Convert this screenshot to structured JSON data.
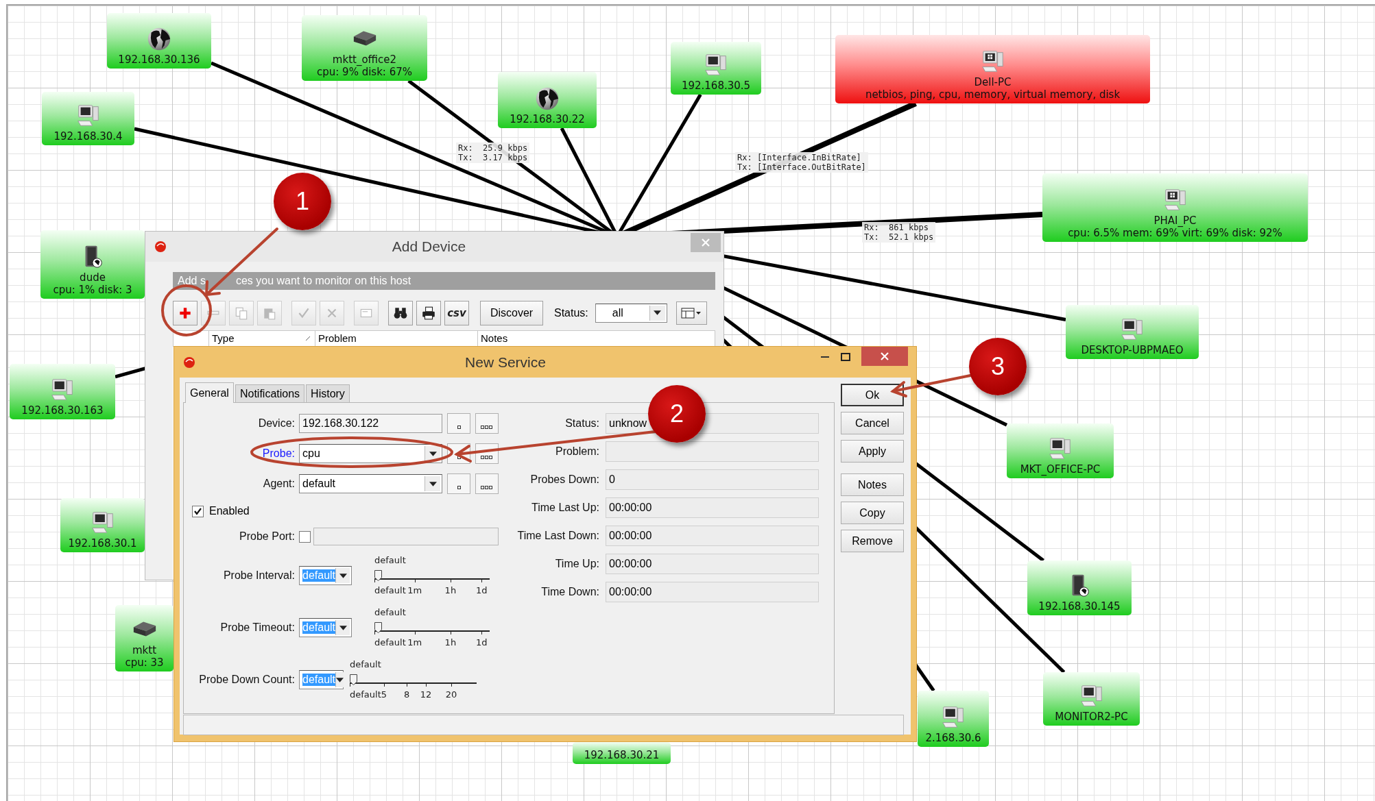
{
  "map": {
    "nodes": [
      {
        "label": "192.168.30.136",
        "down": false
      },
      {
        "label": "mktt_office2",
        "detail": "cpu: 9% disk: 67%",
        "down": false
      },
      {
        "label": "192.168.30.4",
        "down": false
      },
      {
        "label": "192.168.30.22",
        "down": false
      },
      {
        "label": "192.168.30.5",
        "down": false
      },
      {
        "label": "Dell-PC",
        "detail": "netbios, ping, cpu, memory, virtual memory, disk",
        "down": true
      },
      {
        "label": "PHAI_PC",
        "detail": "cpu: 6.5% mem: 69% virt: 69% disk: 92%",
        "down": false
      },
      {
        "label": "dude",
        "detail": "cpu: 1% disk: 3",
        "down": false
      },
      {
        "label": "DESKTOP-UBPMAEO",
        "down": false
      },
      {
        "label": "192.168.30.163",
        "down": false
      },
      {
        "label": "MKT_OFFICE-PC",
        "down": false
      },
      {
        "label": "192.168.30.1",
        "down": false
      },
      {
        "label": "mktt",
        "detail": "cpu: 33",
        "down": false
      },
      {
        "label": "192.168.30.145",
        "down": false
      },
      {
        "label": "MONITOR2-PC",
        "down": false
      },
      {
        "label": "2.168.30.6",
        "down": false
      },
      {
        "label": "192.168.30.21",
        "down": false
      }
    ],
    "link_labels": [
      {
        "rx": "Rx:  25.9 kbps",
        "tx": "Tx:  3.17 kbps"
      },
      {
        "rx": "Rx: [Interface.InBitRate]",
        "tx": "Tx: [Interface.OutBitRate]"
      },
      {
        "rx": "Rx:  861 kbps",
        "tx": "Tx:  52.1 kbps"
      }
    ]
  },
  "add_device": {
    "title": "Add Device",
    "active": false,
    "info_start": "Add s",
    "info_end": "ces you want to monitor on this host",
    "toolbar": [
      {
        "disabled": false
      },
      {
        "disabled": true
      },
      {
        "disabled": true
      },
      {
        "disabled": true
      },
      {
        "disabled": true
      },
      {
        "disabled": true
      },
      {
        "disabled": true
      },
      {
        "disabled": false
      },
      {
        "disabled": false
      },
      {
        "disabled": false,
        "label": "csv"
      }
    ],
    "discover": "Discover",
    "status_label": "Status:",
    "status_value": "all",
    "columns": [
      "Type",
      "Problem",
      "Notes"
    ]
  },
  "new_service": {
    "title": "New Service",
    "active": true,
    "tabs": [
      {
        "label": "General",
        "selected": true
      },
      {
        "label": "Notifications",
        "selected": false
      },
      {
        "label": "History",
        "selected": false
      }
    ],
    "fields": [
      {
        "kind": "text",
        "label": "Device:",
        "value": "192.168.30.122",
        "link": false
      },
      {
        "kind": "dropdown",
        "label": "Probe:",
        "value": "cpu",
        "link": true
      },
      {
        "kind": "dropdown",
        "label": "Agent:",
        "value": "default",
        "link": false
      }
    ],
    "enabled": {
      "label": "Enabled",
      "checked": true
    },
    "probe_port": {
      "label": "Probe Port:",
      "checked": false
    },
    "sliders": [
      {
        "label": "Probe Interval:",
        "value": "default",
        "highlighted": true,
        "top_label": "default",
        "ticks": [
          "default",
          "1m",
          "1h",
          "1d"
        ],
        "level": 0
      },
      {
        "label": "Probe Timeout:",
        "value": "default",
        "highlighted": true,
        "top_label": "default",
        "ticks": [
          "default",
          "1m",
          "1h",
          "1d"
        ],
        "level": 0
      },
      {
        "label": "Probe Down Count:",
        "value": "default",
        "highlighted": true,
        "top_label": "default",
        "ticks": [
          "default",
          "5",
          "8",
          "12",
          "20"
        ],
        "level": 0
      }
    ],
    "status_fields": [
      {
        "label": "Status:",
        "value": "unknow"
      },
      {
        "label": "Problem:"
      },
      {
        "label": "Probes Down:",
        "value": "0"
      },
      {
        "label": "Time Last Up:",
        "value": "00:00:00"
      },
      {
        "label": "Time Last Down:",
        "value": "00:00:00"
      },
      {
        "label": "Time Up:",
        "value": "00:00:00"
      },
      {
        "label": "Time Down:",
        "value": "00:00:00"
      }
    ],
    "buttons": [
      {
        "label": "Ok",
        "focused": true
      },
      {
        "label": "Cancel",
        "focused": false
      },
      {
        "label": "Apply",
        "focused": false
      },
      {
        "label": "Notes",
        "focused": false
      },
      {
        "label": "Copy",
        "focused": false
      },
      {
        "label": "Remove",
        "focused": false
      }
    ]
  },
  "callouts": [
    {
      "number": "1"
    },
    {
      "number": "2"
    },
    {
      "number": "3"
    }
  ]
}
